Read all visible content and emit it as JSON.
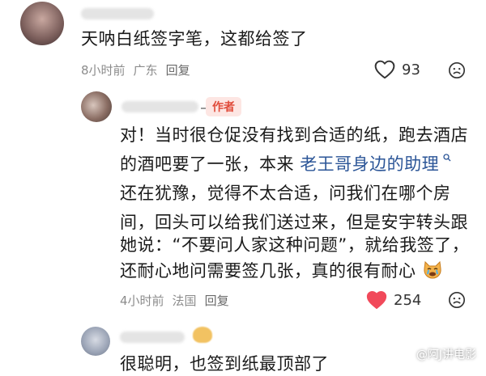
{
  "comment1": {
    "text": "天呐白纸签字笔，这都给签了",
    "time": "8小时前",
    "location": "广东",
    "reply_label": "回复",
    "likes": "93",
    "liked": false
  },
  "comment2": {
    "author_badge": "作者",
    "lines": [
      "对！当时很仓促没有找到合适的纸，跑去酒店",
      "还在犹豫，觉得不太合适，问我们在哪个房",
      "间，回头可以给我们送过来，但是安宇转头跟",
      "她说：“不要问人家这种问题”，就给我签了，",
      "还耐心地问需要签几张，真的很有耐心"
    ],
    "line2_prefix": "的酒吧要了一张，本来",
    "mention": "老王哥身边的助理",
    "time": "4小时前",
    "location": "法国",
    "reply_label": "回复",
    "likes": "254",
    "liked": true
  },
  "comment3": {
    "text": "很聪明，也签到纸最顶部了"
  },
  "watermark": "@阿J讲电影",
  "colors": {
    "liked_heart": "#f1495a",
    "badge_bg": "#fde6e3",
    "badge_text": "#e04c3b",
    "mention": "#2b5597"
  },
  "icons": {
    "like": "heart-icon",
    "dislike": "sad-face-icon",
    "search": "search-icon",
    "emoji": "crying-cat-emoji"
  }
}
